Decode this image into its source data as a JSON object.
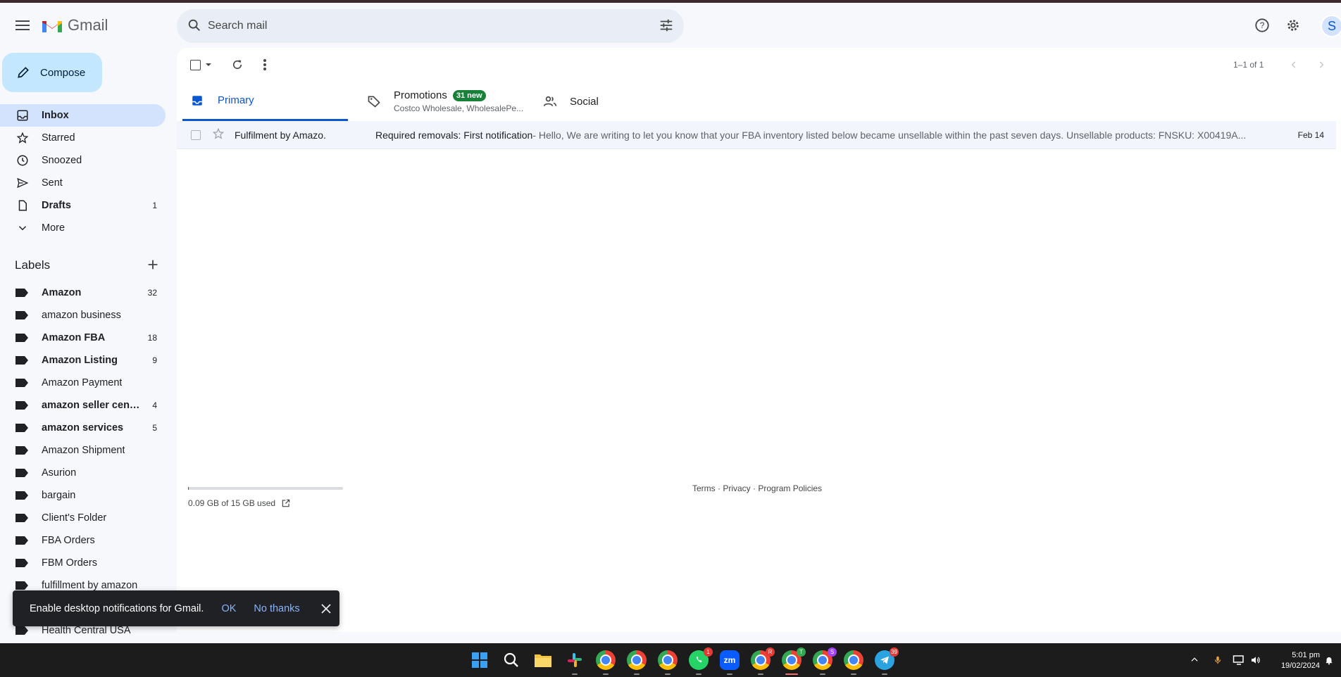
{
  "app": {
    "name": "Gmail"
  },
  "search": {
    "placeholder": "Search mail"
  },
  "header": {
    "avatar_initial": "S"
  },
  "compose": {
    "label": "Compose"
  },
  "nav": [
    {
      "label": "Inbox",
      "count": "",
      "icon": "inbox-icon",
      "active": true
    },
    {
      "label": "Starred",
      "count": "",
      "icon": "star-icon"
    },
    {
      "label": "Snoozed",
      "count": "",
      "icon": "clock-icon"
    },
    {
      "label": "Sent",
      "count": "",
      "icon": "send-icon"
    },
    {
      "label": "Drafts",
      "count": "1",
      "icon": "draft-icon",
      "bold": true
    },
    {
      "label": "More",
      "count": "",
      "icon": "chevron-down-icon"
    }
  ],
  "labels": {
    "heading": "Labels",
    "items": [
      {
        "label": "Amazon",
        "count": "32",
        "bold": true
      },
      {
        "label": "amazon business",
        "count": ""
      },
      {
        "label": "Amazon FBA",
        "count": "18",
        "bold": true
      },
      {
        "label": "Amazon Listing",
        "count": "9",
        "bold": true
      },
      {
        "label": "Amazon Payment",
        "count": ""
      },
      {
        "label": "amazon seller central",
        "count": "4",
        "bold": true
      },
      {
        "label": "amazon services",
        "count": "5",
        "bold": true
      },
      {
        "label": "Amazon Shipment",
        "count": ""
      },
      {
        "label": "Asurion",
        "count": ""
      },
      {
        "label": "bargain",
        "count": ""
      },
      {
        "label": "Client's Folder",
        "count": ""
      },
      {
        "label": "FBA Orders",
        "count": ""
      },
      {
        "label": "FBM Orders",
        "count": ""
      },
      {
        "label": "fulfillment by amazon",
        "count": ""
      },
      {
        "label": "",
        "count": ""
      },
      {
        "label": "Health Central USA",
        "count": ""
      }
    ]
  },
  "toolbar": {
    "pager": "1–1 of 1"
  },
  "tabs": {
    "primary": "Primary",
    "promotions": "Promotions",
    "promotions_badge": "31 new",
    "promotions_sub": "Costco Wholesale, WholesalePe...",
    "social": "Social"
  },
  "emails": [
    {
      "sender": "Fulfilment by Amazo.",
      "subject": "Required removals: First notification",
      "snippet": " - Hello, We are writing to let you know that your FBA inventory listed below became unsellable within the past seven days. Unsellable products: FNSKU: X00419A...",
      "date": "Feb 14"
    }
  ],
  "storage": {
    "text": "0.09 GB of 15 GB used",
    "fraction": 0.006
  },
  "footer": {
    "terms": "Terms",
    "privacy": "Privacy",
    "policies": "Program Policies",
    "sep": " · "
  },
  "snackbar": {
    "message": "Enable desktop notifications for Gmail.",
    "ok": "OK",
    "no_thanks": "No thanks"
  },
  "taskbar": {
    "apps": [
      {
        "name": "windows-start-icon"
      },
      {
        "name": "search-icon"
      },
      {
        "name": "file-explorer-icon"
      },
      {
        "name": "slack-icon"
      },
      {
        "name": "chrome-icon"
      },
      {
        "name": "chrome-icon"
      },
      {
        "name": "chrome-icon"
      },
      {
        "name": "whatsapp-icon",
        "badge": "1"
      },
      {
        "name": "zoom-icon",
        "text": "zm"
      },
      {
        "name": "chrome-icon",
        "badge": "R"
      },
      {
        "name": "chrome-icon",
        "badge": "T"
      },
      {
        "name": "chrome-icon",
        "badge": "S"
      },
      {
        "name": "chrome-icon"
      },
      {
        "name": "telegram-icon",
        "badge": "39"
      }
    ],
    "time": "5:01 pm",
    "date": "19/02/2024"
  },
  "colors": {
    "accent": "#0b57d0",
    "inbox_active_bg": "#d3e3fd",
    "compose_bg": "#c2e7ff",
    "badge_green": "#188038"
  }
}
